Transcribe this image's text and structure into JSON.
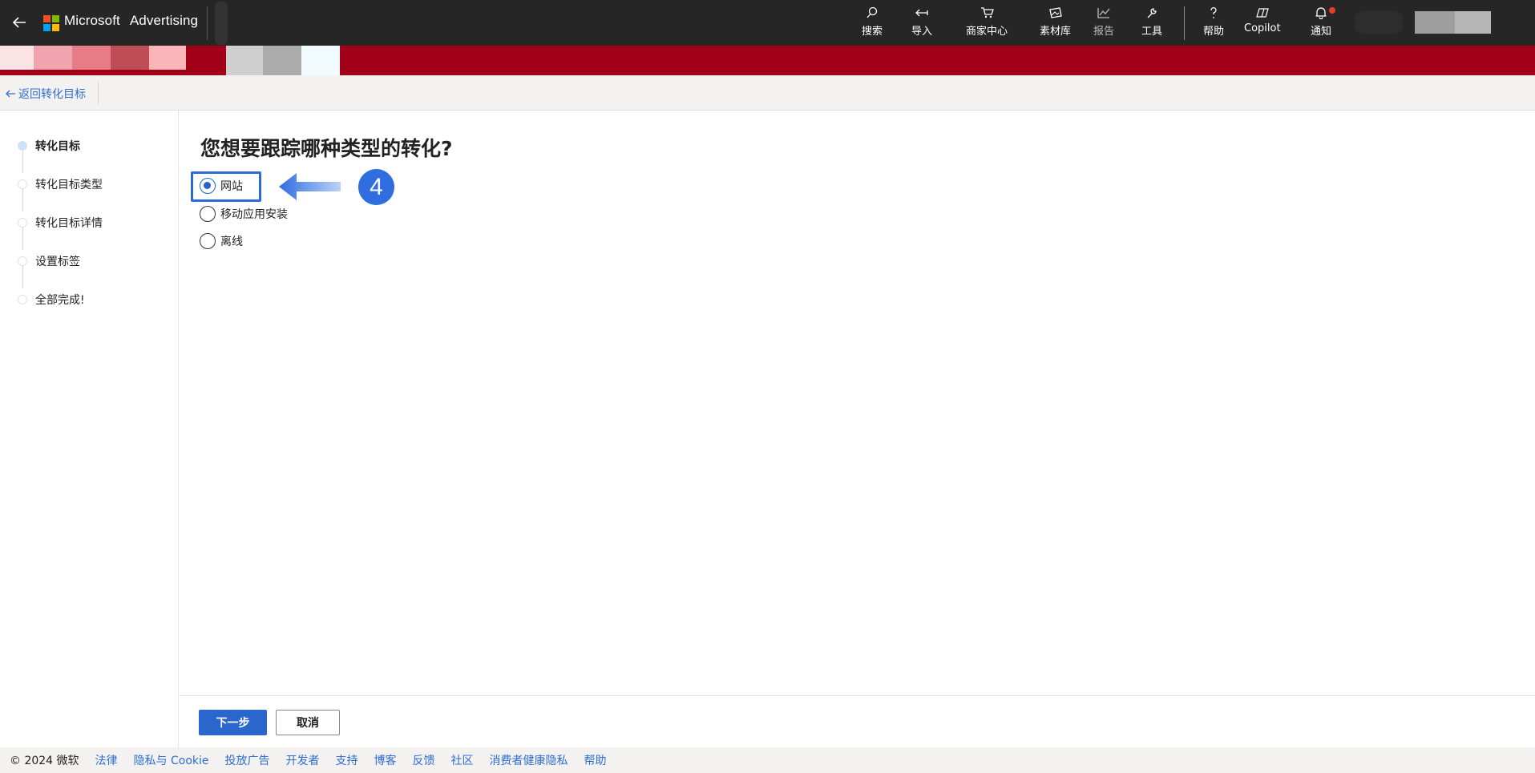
{
  "topbar": {
    "brand_ms": "Microsoft",
    "brand_app": "Advertising",
    "nav": [
      {
        "key": "search",
        "label": "搜索"
      },
      {
        "key": "import",
        "label": "导入"
      },
      {
        "key": "merchant",
        "label": "商家中心"
      },
      {
        "key": "assets",
        "label": "素材库"
      },
      {
        "key": "reports",
        "label": "报告"
      },
      {
        "key": "tools",
        "label": "工具"
      },
      {
        "key": "help",
        "label": "帮助"
      },
      {
        "key": "copilot",
        "label": "Copilot"
      },
      {
        "key": "notify",
        "label": "通知"
      }
    ]
  },
  "breadcrumb": {
    "back_label": "返回转化目标"
  },
  "steps": [
    {
      "label": "转化目标",
      "active": true
    },
    {
      "label": "转化目标类型",
      "active": false
    },
    {
      "label": "转化目标详情",
      "active": false
    },
    {
      "label": "设置标签",
      "active": false
    },
    {
      "label": "全部完成!",
      "active": false
    }
  ],
  "main": {
    "title": "您想要跟踪哪种类型的转化?",
    "options": [
      {
        "label": "网站",
        "selected": true
      },
      {
        "label": "移动应用安装",
        "selected": false
      },
      {
        "label": "离线",
        "selected": false
      }
    ],
    "annotation_badge": "4"
  },
  "form_footer": {
    "next_label": "下一步",
    "cancel_label": "取消"
  },
  "site_footer": {
    "copyright": "© 2024 微软",
    "links": [
      "法律",
      "隐私与 Cookie",
      "投放广告",
      "开发者",
      "支持",
      "博客",
      "反馈",
      "社区",
      "消费者健康隐私",
      "帮助"
    ]
  },
  "colors": {
    "accent": "#2b66cc",
    "banner": "#a20018",
    "topbar": "#262626",
    "link": "#2f6dd0"
  }
}
